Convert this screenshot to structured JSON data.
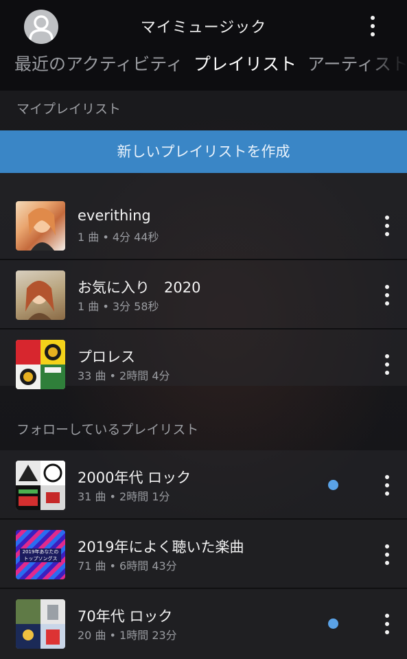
{
  "header": {
    "title": "マイミュージック",
    "tabs": [
      {
        "label": "最近のアクティビティ"
      },
      {
        "label": "プレイリスト"
      },
      {
        "label": "アーティスト"
      }
    ]
  },
  "my_playlists": {
    "section_label": "マイプレイリスト",
    "create_label": "新しいプレイリストを作成",
    "items": [
      {
        "title": "everithing",
        "meta": "1 曲 • 4分 44秒"
      },
      {
        "title": "お気に入り　2020",
        "meta": "1 曲 • 3分 58秒"
      },
      {
        "title": "プロレス",
        "meta": "33 曲 • 2時間 4分"
      }
    ]
  },
  "followed_playlists": {
    "section_label": "フォローしているプレイリスト",
    "items": [
      {
        "title": "2000年代 ロック",
        "meta": "31 曲 • 2時間 1分",
        "badge": true
      },
      {
        "title": "2019年によく聴いた楽曲",
        "meta": "71 曲 • 6時間 43分",
        "badge": false,
        "cover_text_1": "2019年あなたの",
        "cover_text_2": "トップソングス"
      },
      {
        "title": "70年代 ロック",
        "meta": "20 曲 • 1時間 23分",
        "badge": true
      }
    ]
  },
  "colors": {
    "accent": "#3a86c6",
    "badge": "#5aa2e6",
    "background": "#121316"
  },
  "icons": {
    "avatar": "user-avatar-icon",
    "menu": "kebab-menu-icon"
  }
}
